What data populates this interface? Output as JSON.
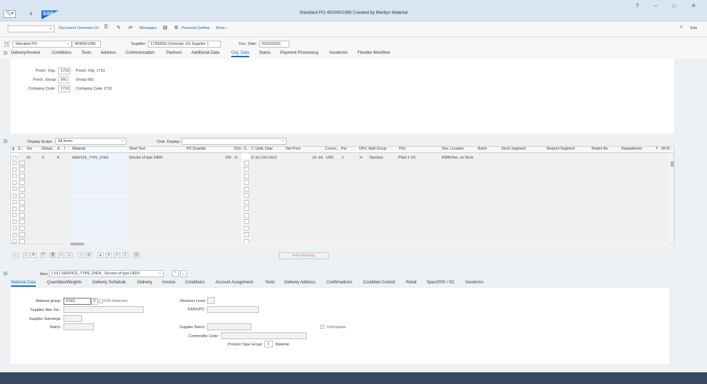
{
  "shell": {
    "title": "Standard PO 4500001086 Created by Marilyn Material",
    "logo": "SAP",
    "menu_icon": "search-icon"
  },
  "toolbar": {
    "document_overview": "Document Overview On",
    "messages": "Messages",
    "personal_setting": "Personal Setting",
    "more": "More",
    "exit": "Exit"
  },
  "header": {
    "doc_type": "Standard PO",
    "po_number": "4500001086",
    "supplier_label": "Supplier:",
    "supplier_value": "17300001 Domestic US Supplier 1",
    "doc_date_label": "Doc. Date:",
    "doc_date_value": "02/22/2022"
  },
  "header_tabs": [
    "Delivery/Invoice",
    "Conditions",
    "Texts",
    "Address",
    "Communication",
    "Partners",
    "Additional Data",
    "Org. Data",
    "Status",
    "Payment Processing",
    "Incoterms",
    "Flexible Workflow"
  ],
  "org_data": {
    "purch_org_label": "Purch. Org.:",
    "purch_org_value": "1710",
    "purch_org_desc": "Purch. Org. 1710",
    "purch_group_label": "Purch. Group:",
    "purch_group_value": "001",
    "purch_group_desc": "Group 001",
    "company_code_label": "Company Code:",
    "company_code_value": "1710",
    "company_code_desc": "Company Code 1710"
  },
  "item_overview": {
    "display_scope_label": "Display Scope:",
    "display_scope_value": "All Items",
    "char_display_label": "Char. Display:",
    "char_display_value": "",
    "columns": [
      "S...",
      "Itm",
      "Global...",
      "A",
      "I",
      "Material",
      "Short Text",
      "PO Quantity",
      "OUn",
      "S...",
      "C",
      "Deliv. Date",
      "Net Price",
      "Curren...",
      "Per",
      "OPU",
      "Matl Group",
      "Plnt",
      "Stor. Location",
      "Batch",
      "Stock Segment",
      "Reqmnt Segment",
      "Reqmt No.",
      "Requisitioner",
      "T",
      "IM M..."
    ],
    "row": {
      "itm": "10",
      "global": "0",
      "i": "K",
      "material": "SERVICE_TYPE_DIEN",
      "short_text": "Service of type DIEN",
      "po_quantity": "100",
      "oun": "H",
      "c": "D",
      "deliv_date": "02/28/2022",
      "net_price": "10.00",
      "currency": "USD",
      "per": "1",
      "opu": "H",
      "matl_group": "Services",
      "plnt": "Plant 1 US",
      "stor_location": "EWM Rec. on Dock"
    },
    "add_planning": "Add Planning"
  },
  "item_detail": {
    "item_label": "Item:",
    "item_value": "[ 10 ] SERVICE_TYPE_DIEN , Service of type DIEN",
    "tabs": [
      "Material Data",
      "Quantities/Weights",
      "Delivery Schedule",
      "Delivery",
      "Invoice",
      "Conditions",
      "Account Assignment",
      "Texts",
      "Delivery Address",
      "Confirmations",
      "Condition Control",
      "Retail",
      "Spec2000 / SC",
      "Incoterms"
    ],
    "material_group_label": "Material group:",
    "material_group_value": "P001",
    "iuid_label": "IUID-Relevant",
    "supplier_mat_label": "Supplier Mat. No.:",
    "supplier_subrange_label": "Supplier Subrange:",
    "batch_label": "Batch:",
    "revision_label": "Revision Level:",
    "ean_label": "EAN/UPC:",
    "supplier_batch_label": "Supplier Batch:",
    "infoupdate_label": "InfoUpdate",
    "commodity_label": "Commodity Code:",
    "product_type_label": "Product Type Group:",
    "product_type_value": "1",
    "product_type_desc": "Material"
  }
}
